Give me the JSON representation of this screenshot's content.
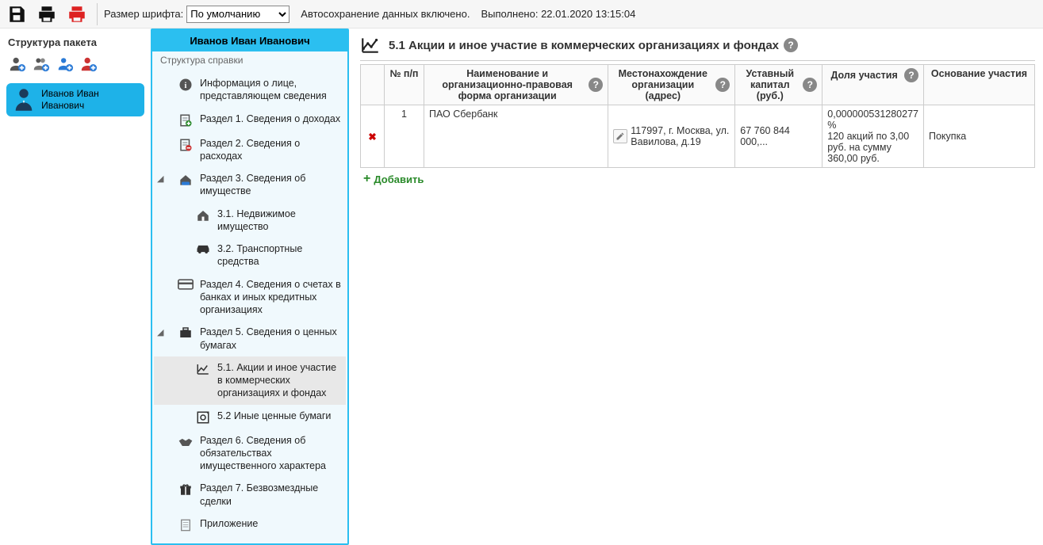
{
  "toolbar": {
    "font_label": "Размер шрифта:",
    "font_value": "По умолчанию",
    "autosave": "Автосохранение данных включено.",
    "done": "Выполнено: 22.01.2020 13:15:04"
  },
  "left": {
    "title": "Структура пакета",
    "person": "Иванов Иван Иванович"
  },
  "tree": {
    "header": "Иванов Иван Иванович",
    "sub": "Структура справки",
    "items": {
      "info": "Информация о лице, представляющем сведения",
      "s1": "Раздел 1. Сведения о доходах",
      "s2": "Раздел 2. Сведения о расходах",
      "s3": "Раздел 3. Сведения об имуществе",
      "s31": "3.1. Недвижимое имущество",
      "s32": "3.2. Транспортные средства",
      "s4": "Раздел 4. Сведения о счетах в банках и иных кредитных организациях",
      "s5": "Раздел 5. Сведения о ценных бумагах",
      "s51": "5.1. Акции и иное участие в коммерческих организациях и фондах",
      "s52": "5.2 Иные ценные бумаги",
      "s6": "Раздел 6. Сведения об обязательствах имущественного характера",
      "s7": "Раздел 7. Безвозмездные сделки",
      "app": "Приложение"
    }
  },
  "content": {
    "title": "5.1 Акции и иное участие в коммерческих организациях и фондах",
    "headers": {
      "num": "№ п/п",
      "name": "Наименование и организационно-правовая форма организации",
      "addr": "Местонахождение организации (адрес)",
      "capital": "Уставный капитал (руб.)",
      "share": "Доля участия",
      "basis": "Основание участия"
    },
    "row": {
      "num": "1",
      "name": "ПАО Сбербанк",
      "addr": "117997, г. Москва, ул. Вавилова, д.19",
      "capital": "67 760 844 000,...",
      "share": "0,000000531280277 %\n120 акций по 3,00  руб. на сумму 360,00 руб.",
      "basis": "Покупка"
    },
    "add": "Добавить"
  }
}
